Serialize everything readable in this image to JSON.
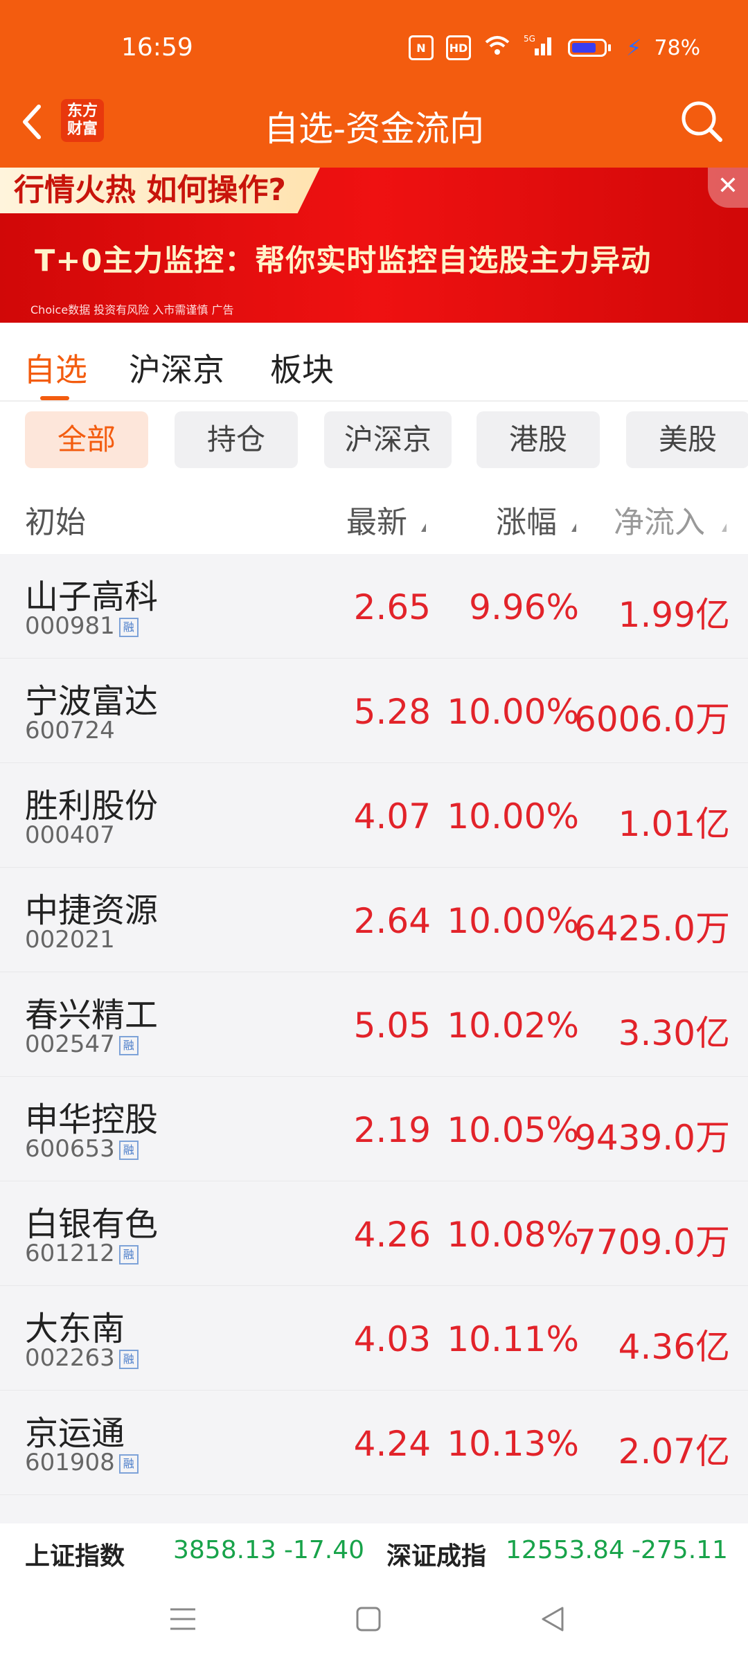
{
  "status": {
    "time": "16:59",
    "battery": "78%",
    "battery_level": 0.78,
    "network": "5G"
  },
  "header": {
    "title": "自选-资金流向",
    "logo_text_1": "东方",
    "logo_text_2": "财富"
  },
  "banner": {
    "tag": "行情火热 如何操作?",
    "main": "T+0主力监控：帮你实时监控自选股主力异动",
    "footer": "Choice数据  投资有风险 入市需谨慎 广告"
  },
  "tabs": [
    "自选",
    "沪深京",
    "板块"
  ],
  "chips": [
    "全部",
    "持仓",
    "沪深京",
    "港股",
    "美股"
  ],
  "columns": {
    "name": "初始",
    "price": "最新",
    "change": "涨幅",
    "flow": "净流入"
  },
  "stocks": [
    {
      "name": "山子高科",
      "code": "000981",
      "rong": "融",
      "price": "2.65",
      "change": "9.96%",
      "flow": "1.99亿"
    },
    {
      "name": "宁波富达",
      "code": "600724",
      "rong": "",
      "price": "5.28",
      "change": "10.00%",
      "flow": "6006.0万"
    },
    {
      "name": "胜利股份",
      "code": "000407",
      "rong": "",
      "price": "4.07",
      "change": "10.00%",
      "flow": "1.01亿"
    },
    {
      "name": "中捷资源",
      "code": "002021",
      "rong": "",
      "price": "2.64",
      "change": "10.00%",
      "flow": "6425.0万"
    },
    {
      "name": "春兴精工",
      "code": "002547",
      "rong": "融",
      "price": "5.05",
      "change": "10.02%",
      "flow": "3.30亿"
    },
    {
      "name": "申华控股",
      "code": "600653",
      "rong": "融",
      "price": "2.19",
      "change": "10.05%",
      "flow": "9439.0万"
    },
    {
      "name": "白银有色",
      "code": "601212",
      "rong": "融",
      "price": "4.26",
      "change": "10.08%",
      "flow": "7709.0万"
    },
    {
      "name": "大东南",
      "code": "002263",
      "rong": "融",
      "price": "4.03",
      "change": "10.11%",
      "flow": "4.36亿"
    },
    {
      "name": "京运通",
      "code": "601908",
      "rong": "融",
      "price": "4.24",
      "change": "10.13%",
      "flow": "2.07亿"
    }
  ],
  "indices": {
    "sh_name": "上证指数",
    "sh_value": "3858.13",
    "sh_change": "-17.40",
    "sz_name": "深证成指",
    "sz_value": "12553.84",
    "sz_change": "-275.11"
  },
  "colors": {
    "brand": "#f35c0f",
    "up": "#e2232a",
    "down": "#18a34a"
  }
}
